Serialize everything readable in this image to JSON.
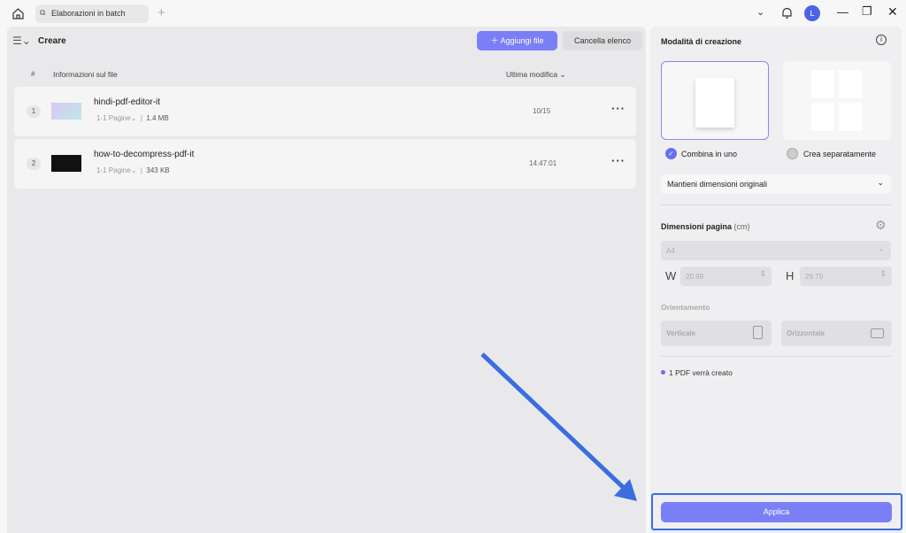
{
  "titlebar": {
    "tab_label": "Elaborazioni in batch",
    "user_initial": "L"
  },
  "left": {
    "title": "Creare",
    "add_button": "Aggiungi file",
    "clear_button": "Cancella elenco",
    "columns": {
      "num": "#",
      "info": "Informazioni sul file",
      "modified": "Ultima modifica"
    },
    "files": [
      {
        "index": "1",
        "name": "hindi-pdf-editor-it",
        "pages": "1-1 Pagine",
        "size": "1.4 MB",
        "modified": "10/15"
      },
      {
        "index": "2",
        "name": "how-to-decompress-pdf-it",
        "pages": "1-1 Pagine",
        "size": "343 KB",
        "modified": "14:47:01"
      }
    ]
  },
  "right": {
    "mode_title": "Modalità di creazione",
    "combine": "Combina in uno",
    "separate": "Crea separatamente",
    "size_select": "Mantieni dimensioni originali",
    "page_size_title": "Dimensioni pagina",
    "unit": "(cm)",
    "paper": "A4",
    "w_label": "W",
    "w_value": "20.99",
    "h_label": "H",
    "h_value": "29.70",
    "orientation_title": "Orientamento",
    "portrait": "Verticale",
    "landscape": "Orizzontale",
    "result_note": "1 PDF verrà creato",
    "apply": "Applica"
  },
  "colors": {
    "accent": "#7b7ff5",
    "arrow": "#3b6de0"
  }
}
